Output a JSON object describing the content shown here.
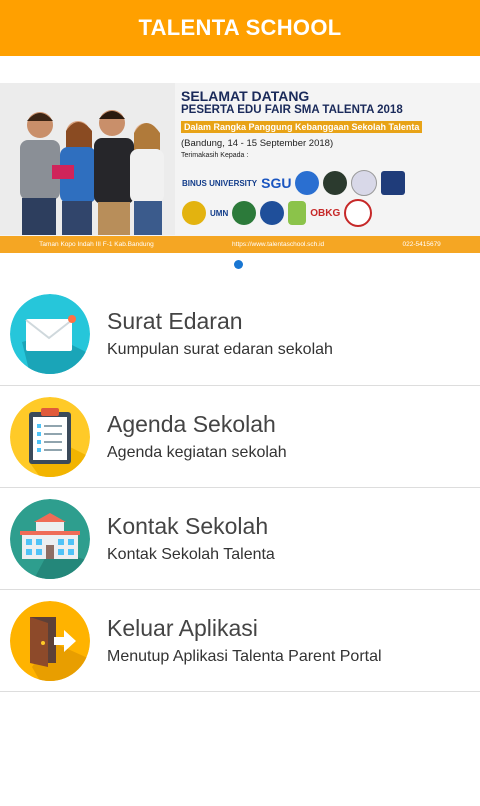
{
  "app": {
    "title": "TALENTA SCHOOL"
  },
  "banner": {
    "heading1": "SELAMAT DATANG",
    "heading2": "PESERTA EDU FAIR SMA TALENTA 2018",
    "heading3": "Dalam Rangka Panggung Kebanggaan Sekolah Talenta",
    "date": "(Bandung, 14 - 15 September 2018)",
    "thanks": "Terimakasih Kepada :",
    "logos": [
      "BINUS UNIVERSITY",
      "SGU",
      "UMN",
      "OBKG"
    ],
    "footer": {
      "address": "Taman Kopo Indah III F-1 Kab.Bandung",
      "website": "https://www.talentaschool.sch.id",
      "phone": "022-5415679"
    }
  },
  "carousel": {
    "active_index": 1,
    "count": 1
  },
  "colors": {
    "appbar": "#FFA000",
    "accent": "#1976D2"
  },
  "menu": [
    {
      "icon": "envelope-icon",
      "title": "Surat Edaran",
      "subtitle": "Kumpulan surat edaran sekolah"
    },
    {
      "icon": "clipboard-icon",
      "title": "Agenda Sekolah",
      "subtitle": "Agenda kegiatan sekolah"
    },
    {
      "icon": "school-building-icon",
      "title": "Kontak Sekolah",
      "subtitle": "Kontak Sekolah Talenta"
    },
    {
      "icon": "exit-door-icon",
      "title": "Keluar Aplikasi",
      "subtitle": "Menutup Aplikasi Talenta Parent Portal"
    }
  ]
}
